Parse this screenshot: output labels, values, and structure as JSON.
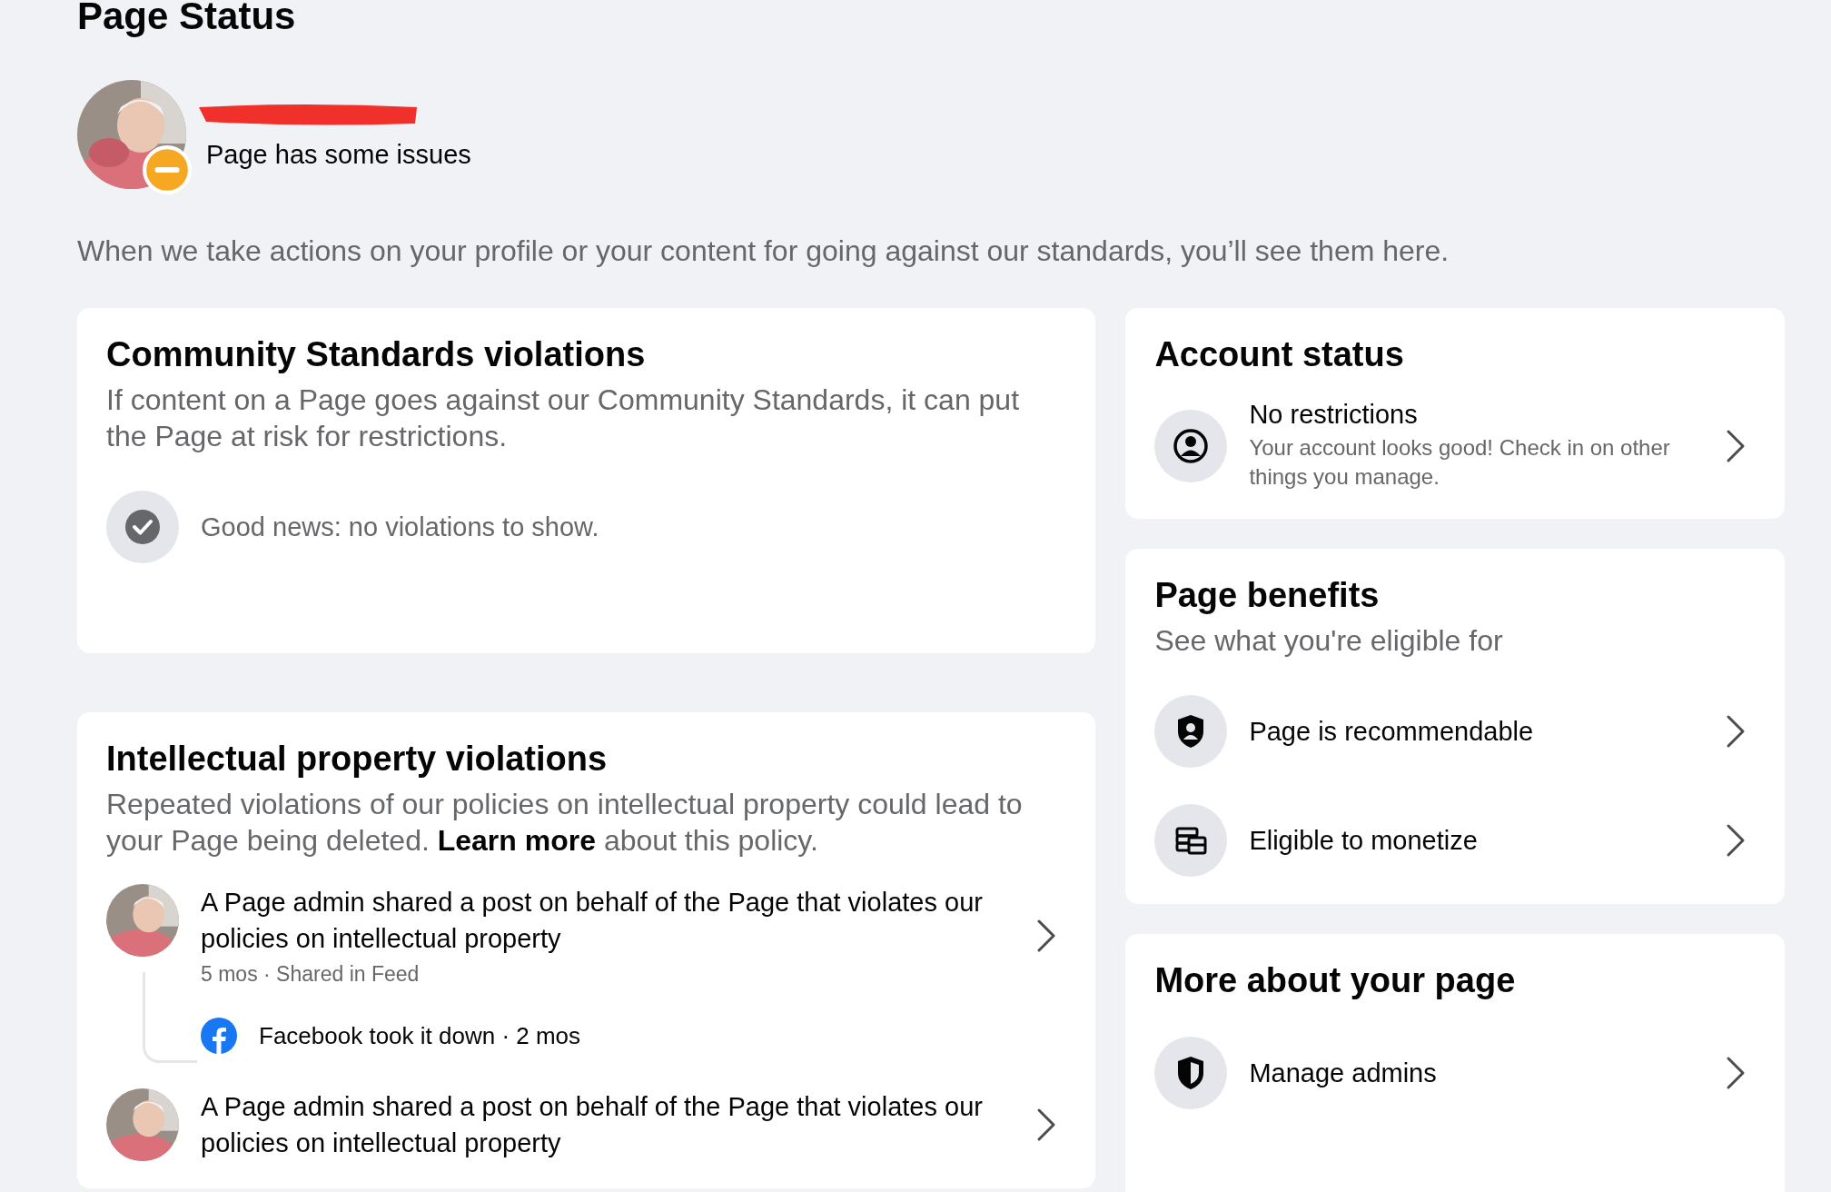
{
  "page_title": "Page Status",
  "page": {
    "status": "Page has some issues",
    "kind": "warning",
    "name_redacted": true
  },
  "intro": "When we take actions on your profile or your content for going against our standards, you’ll see them here.",
  "community": {
    "title": "Community Standards violations",
    "description": "If content on a Page goes against our Community Standards, it can put the Page at risk for restrictions.",
    "empty_message": "Good news: no violations to show."
  },
  "ip": {
    "title": "Intellectual property violations",
    "description_before": "Repeated violations of our policies on intellectual property could lead to your Page being deleted.",
    "link": "Learn more",
    "description_after": "about this policy.",
    "violations": [
      {
        "text": "A Page admin shared a post on behalf of the Page that violates our policies on intellectual property",
        "meta": "5 mos · Shared in Feed",
        "action": "Facebook took it down · 2 mos"
      },
      {
        "text": "A Page admin shared a post on behalf of the Page that violates our policies on intellectual property"
      }
    ]
  },
  "account_status": {
    "title": "Account status",
    "items": [
      {
        "kind": "person",
        "title": "No restrictions",
        "subtitle": "Your account looks good! Check in on other things you manage."
      }
    ]
  },
  "benefits": {
    "title": "Page benefits",
    "subtitle": "See what you're eligible for",
    "items": [
      {
        "kind": "shield-person",
        "title": "Page is recommendable"
      },
      {
        "kind": "coins",
        "title": "Eligible to monetize"
      }
    ]
  },
  "more": {
    "title": "More about your page",
    "items": [
      {
        "kind": "shield",
        "title": "Manage admins"
      }
    ]
  }
}
